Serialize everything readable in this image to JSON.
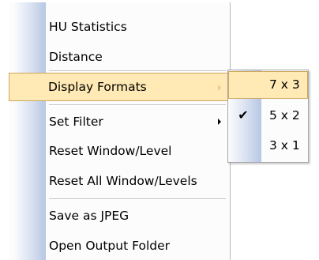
{
  "context_menu": {
    "items": [
      {
        "label": "HU Statistics"
      },
      {
        "label": "Distance"
      },
      {
        "label": "Display Formats"
      },
      {
        "label": "Set Filter"
      },
      {
        "label": "Reset Window/Level"
      },
      {
        "label": "Reset All Window/Levels"
      },
      {
        "label": "Save as JPEG"
      },
      {
        "label": "Open Output Folder"
      }
    ],
    "highlighted_item": "Display Formats",
    "submenu_item": "Display Formats"
  },
  "display_formats_submenu": {
    "items": [
      {
        "label": "7 x 3",
        "checked": false
      },
      {
        "label": "5 x 2",
        "checked": true
      },
      {
        "label": "3 x 1",
        "checked": false
      }
    ],
    "highlighted_item": "7 x 3",
    "check_glyph": "✔"
  },
  "colors": {
    "highlight_fill": "#ffe9b4",
    "highlight_border": "#cda95f",
    "gutter": "#b7c7e4"
  },
  "icons": [
    "submenu-arrow-icon",
    "checkmark-icon"
  ]
}
